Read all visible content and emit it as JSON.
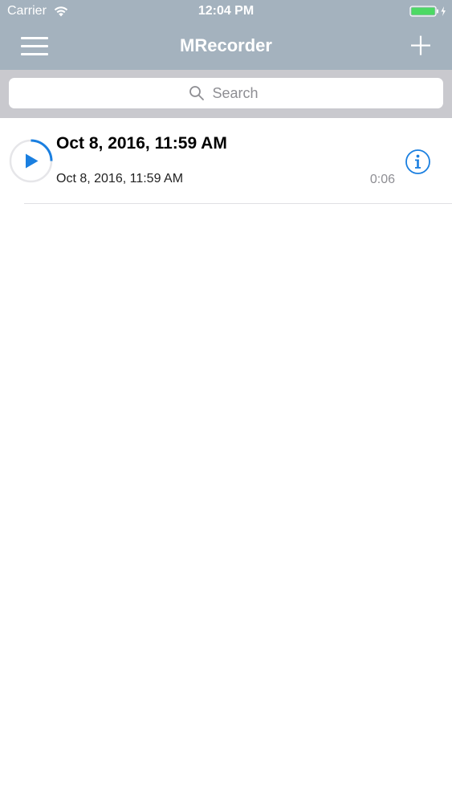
{
  "status_bar": {
    "carrier": "Carrier",
    "time": "12:04 PM",
    "wifi_icon": "wifi-icon",
    "battery_icon": "battery-charging-icon",
    "battery_color": "#4cd964"
  },
  "nav": {
    "title": "MRecorder",
    "menu_icon": "hamburger-menu-icon",
    "add_icon": "plus-icon",
    "background_color": "#a4b2be"
  },
  "search": {
    "placeholder": "Search",
    "value": "",
    "icon": "search-icon"
  },
  "recordings": [
    {
      "title": "Oct 8, 2016, 11:59 AM",
      "subtitle": "Oct 8, 2016, 11:59 AM",
      "duration": "0:06",
      "play_icon": "play-icon",
      "info_icon": "info-icon",
      "accent_color": "#1a7fe0"
    }
  ]
}
